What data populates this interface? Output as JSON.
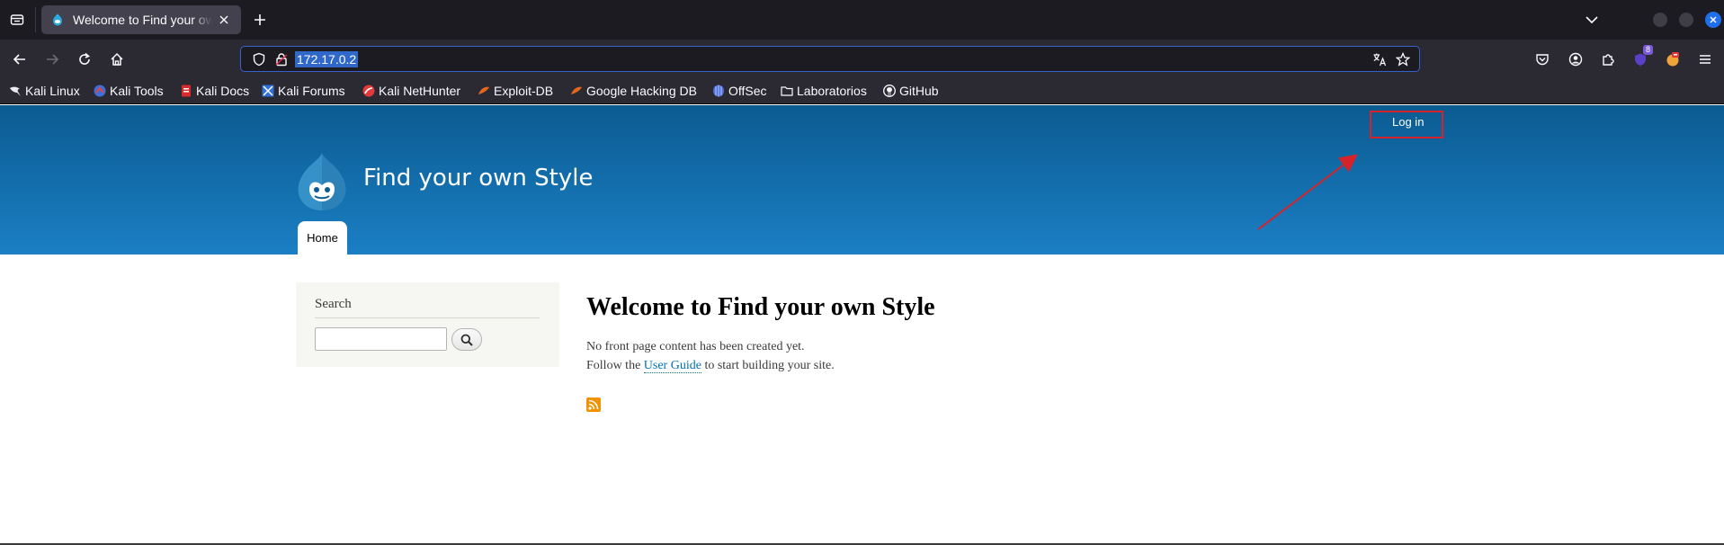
{
  "browser": {
    "tab_title": "Welcome to Find your own Style",
    "url": "172.17.0.2",
    "extension_badge": "8",
    "bookmarks": [
      {
        "label": "Kali Linux",
        "icon": "kali-dragon-icon"
      },
      {
        "label": "Kali Tools",
        "icon": "kali-tools-icon"
      },
      {
        "label": "Kali Docs",
        "icon": "kali-docs-icon"
      },
      {
        "label": "Kali Forums",
        "icon": "kali-forums-icon"
      },
      {
        "label": "Kali NetHunter",
        "icon": "kali-nethunter-icon"
      },
      {
        "label": "Exploit-DB",
        "icon": "exploit-db-icon"
      },
      {
        "label": "Google Hacking DB",
        "icon": "google-hacking-db-icon"
      },
      {
        "label": "OffSec",
        "icon": "offsec-icon"
      },
      {
        "label": "Laboratorios",
        "icon": "folder-icon"
      },
      {
        "label": "GitHub",
        "icon": "github-icon"
      }
    ]
  },
  "site": {
    "login_label": "Log in",
    "name": "Find your own Style",
    "nav_home": "Home",
    "search_title": "Search",
    "main_title": "Welcome to Find your own Style",
    "text_line1": "No front page content has been created yet.",
    "text_follow": "Follow the ",
    "text_link": "User Guide",
    "text_after": " to start building your site."
  },
  "colors": {
    "header_top": "#0b5b91",
    "header_bottom": "#1b7fc4",
    "annotation_red": "#d6232a",
    "link_blue": "#0071b3"
  }
}
